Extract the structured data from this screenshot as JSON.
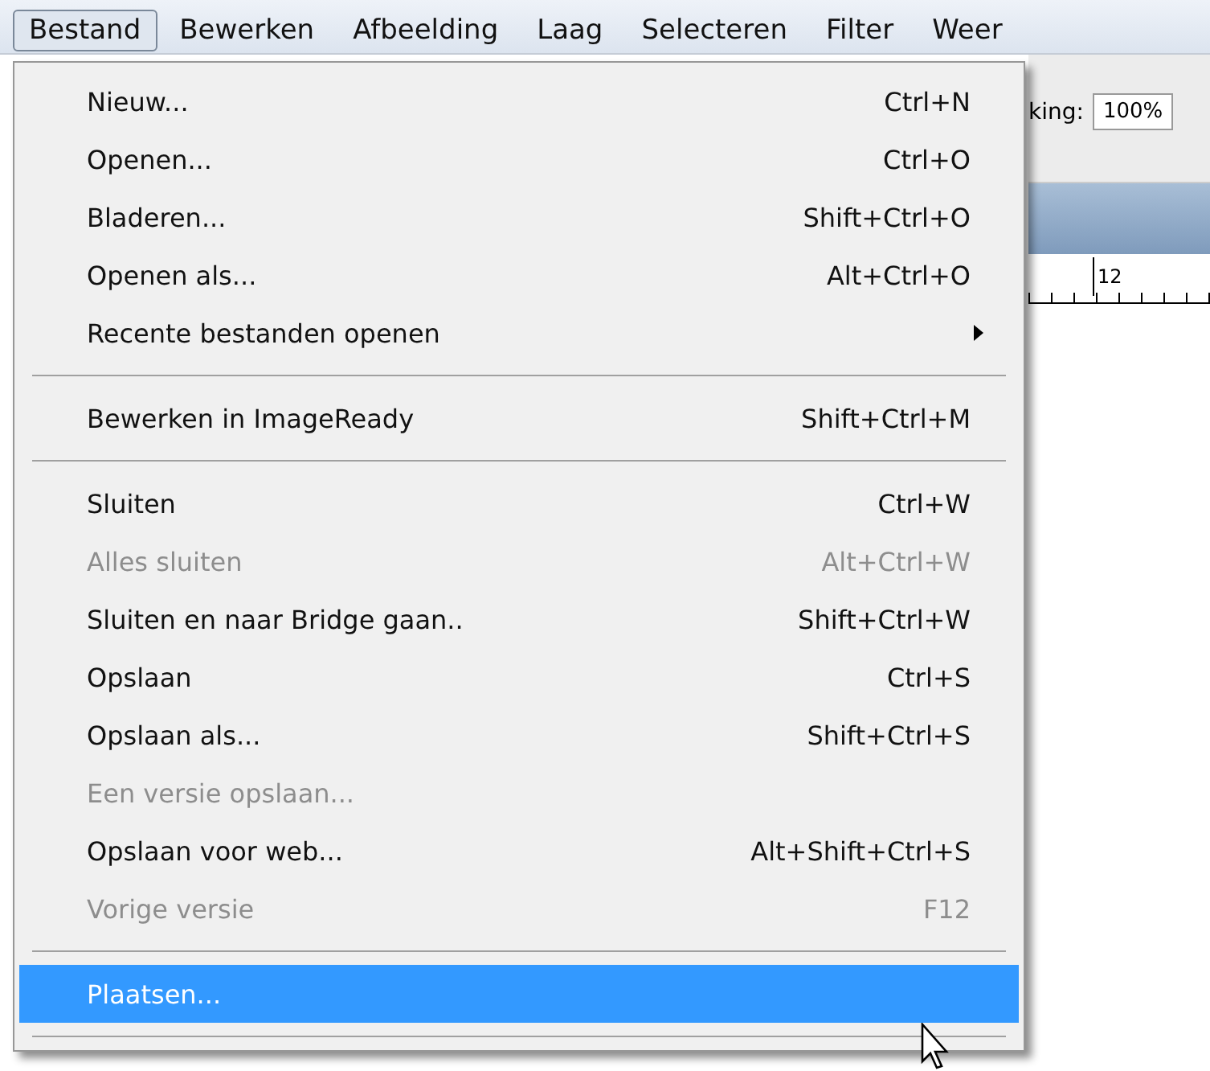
{
  "menubar": [
    {
      "label": "Bestand",
      "selected": true
    },
    {
      "label": "Bewerken",
      "selected": false
    },
    {
      "label": "Afbeelding",
      "selected": false
    },
    {
      "label": "Laag",
      "selected": false
    },
    {
      "label": "Selecteren",
      "selected": false
    },
    {
      "label": "Filter",
      "selected": false
    },
    {
      "label": "Weer",
      "selected": false
    }
  ],
  "toolbar": {
    "label": "king:",
    "field_value": "100%"
  },
  "ruler": {
    "label": "12"
  },
  "menu": [
    {
      "kind": "item",
      "label": "Nieuw...",
      "shortcut": "Ctrl+N",
      "disabled": false,
      "submenu": false,
      "selected": false
    },
    {
      "kind": "item",
      "label": "Openen...",
      "shortcut": "Ctrl+O",
      "disabled": false,
      "submenu": false,
      "selected": false
    },
    {
      "kind": "item",
      "label": "Bladeren...",
      "shortcut": "Shift+Ctrl+O",
      "disabled": false,
      "submenu": false,
      "selected": false
    },
    {
      "kind": "item",
      "label": "Openen als...",
      "shortcut": "Alt+Ctrl+O",
      "disabled": false,
      "submenu": false,
      "selected": false
    },
    {
      "kind": "item",
      "label": "Recente bestanden openen",
      "disabled": false,
      "submenu": true,
      "selected": false
    },
    {
      "kind": "separator"
    },
    {
      "kind": "item",
      "label": "Bewerken in ImageReady",
      "shortcut": "Shift+Ctrl+M",
      "disabled": false,
      "submenu": false,
      "selected": false
    },
    {
      "kind": "separator"
    },
    {
      "kind": "item",
      "label": "Sluiten",
      "shortcut": "Ctrl+W",
      "disabled": false,
      "submenu": false,
      "selected": false
    },
    {
      "kind": "item",
      "label": "Alles sluiten",
      "shortcut": "Alt+Ctrl+W",
      "disabled": true,
      "submenu": false,
      "selected": false
    },
    {
      "kind": "item",
      "label": "Sluiten en naar Bridge gaan..",
      "shortcut": "Shift+Ctrl+W",
      "disabled": false,
      "submenu": false,
      "selected": false
    },
    {
      "kind": "item",
      "label": "Opslaan",
      "shortcut": "Ctrl+S",
      "disabled": false,
      "submenu": false,
      "selected": false
    },
    {
      "kind": "item",
      "label": "Opslaan als...",
      "shortcut": "Shift+Ctrl+S",
      "disabled": false,
      "submenu": false,
      "selected": false
    },
    {
      "kind": "item",
      "label": "Een versie opslaan...",
      "disabled": true,
      "submenu": false,
      "selected": false
    },
    {
      "kind": "item",
      "label": "Opslaan voor web...",
      "shortcut": "Alt+Shift+Ctrl+S",
      "disabled": false,
      "submenu": false,
      "selected": false
    },
    {
      "kind": "item",
      "label": "Vorige versie",
      "shortcut": "F12",
      "disabled": true,
      "submenu": false,
      "selected": false
    },
    {
      "kind": "separator"
    },
    {
      "kind": "item",
      "label": "Plaatsen...",
      "disabled": false,
      "submenu": false,
      "selected": true
    },
    {
      "kind": "separator"
    }
  ]
}
